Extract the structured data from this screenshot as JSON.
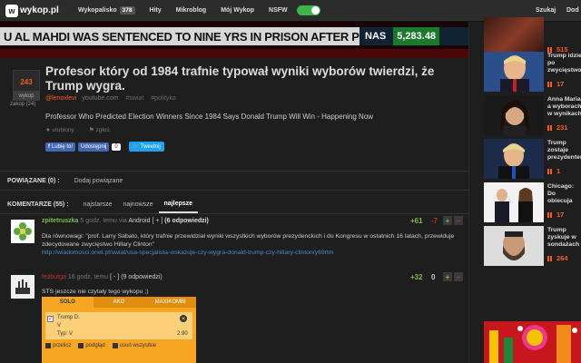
{
  "header": {
    "logo_mark": "w",
    "logo_text": "wykop.pl",
    "nav": [
      {
        "label": "Wykopalisko",
        "badge": "378"
      },
      {
        "label": "Hity"
      },
      {
        "label": "Mikroblog"
      },
      {
        "label": "Mój Wykop"
      },
      {
        "label": "NSFW"
      }
    ],
    "nsfw_enabled": true,
    "search_label": "Szukaj",
    "add_label": "Dod"
  },
  "video": {
    "ticker_text": "U AL MAHDI WAS SENTENCED TO NINE YRS IN PRISON AFTER P",
    "index_label": "NAS",
    "index_value": "5,283.48"
  },
  "article": {
    "votes": "243",
    "vote_button": "wykop",
    "vote_caption": "zakop (24)",
    "title": "Profesor który od 1984 trafnie typował wyniki wyborów twierdzi, że Trump wygra.",
    "author": "@lenoxlevi",
    "domain": "youtube.com",
    "tags": [
      "#swiat",
      "#polityka"
    ],
    "description": "Professor Who Predicted Election Winners Since 1984 Says Donald Trump Will Win - Happening Now",
    "actions": [
      "ulubiony",
      "zgłoś"
    ],
    "social": {
      "like_label": "Lubię to!",
      "share_label": "Udostępnij",
      "share_count": "0",
      "tweet_label": "Tweetnij"
    }
  },
  "related": {
    "label": "POWIĄZANE (0) :",
    "add_label": "Dodaj powiązane"
  },
  "comments_bar": {
    "label": "KOMENTARZE (55) :",
    "sort_tabs": [
      {
        "label": "najstarsze",
        "active": false
      },
      {
        "label": "najnowsze",
        "active": false
      },
      {
        "label": "najlepsze",
        "active": true
      }
    ]
  },
  "comments": [
    {
      "user": "zpitetruszka",
      "time": "5 godz. temu",
      "via": "via",
      "app": "Android",
      "toggle": "[ + ]",
      "replies": "(6 odpowiedzi)",
      "score_plus": "+61",
      "score_minus": "-7",
      "text": "Dla równowagi: \"prof. Larry Sabato, który trafnie przewidział wyniki wszystkich wyborów prezydenckich i do Kongresu w ostatnich 16 latach, przewiduje zdecydowane zwycięstwo Hillary Clinton\"",
      "link": "http://wiadomosci.onet.pl/swiat/usa-specjalista-wskazuje-czy-wygra-donald-trump-czy-hillary-clinton/y69rtm"
    },
    {
      "user": "fezbutga",
      "time": "16 godz. temu",
      "toggle": "[ - ]",
      "replies": "(9 odpowiedzi)",
      "score_plus": "+32",
      "score_minus": "0",
      "text": "STS jeszcze nie czytały tego wykopu ;)"
    }
  ],
  "bet_widget": {
    "tabs": [
      "SOLO",
      "AKO",
      "MAXIKOMBI"
    ],
    "selection": "Trump D.",
    "choice": "V",
    "type": "Typ: V",
    "odd": "2.90",
    "actions": [
      "przelicz",
      "podgląd",
      "usuń wszystkie"
    ]
  },
  "sidebar": [
    {
      "title": "",
      "votes": "515"
    },
    {
      "title": "Trump idzie po zwycięstwo w stanów w jeg wygra.",
      "votes": "17"
    },
    {
      "title": "Anna Maria a wyborach w wynikach niczym",
      "votes": "231"
    },
    {
      "title": "Trump zostaje prezydentem",
      "votes": "1"
    },
    {
      "title": "Chicago: Do obiecuja zniesienie Polaków",
      "votes": "17"
    },
    {
      "title": "Trump zyskuje w sondażach Parlamentu",
      "votes": "264"
    }
  ],
  "colors": {
    "accent": "#ff5917",
    "green": "#7bbf45",
    "red": "#c0302a",
    "link": "#4a8ac8",
    "toggle": "#3bb44a"
  }
}
